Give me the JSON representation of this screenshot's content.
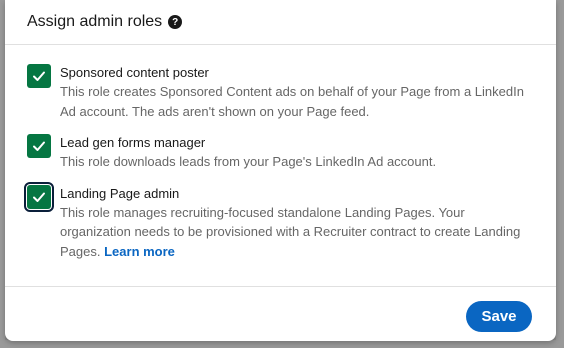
{
  "modal": {
    "title": "Assign admin roles",
    "help_icon": "question-circle-icon"
  },
  "roles": [
    {
      "title": "Sponsored content poster",
      "description": "This role creates Sponsored Content ads on behalf of your Page from a LinkedIn Ad account. The ads aren't shown on your Page feed.",
      "checked": true
    },
    {
      "title": "Lead gen forms manager",
      "description": "This role downloads leads from your Page's LinkedIn Ad account.",
      "checked": true
    },
    {
      "title": "Landing Page admin",
      "description": "This role manages recruiting-focused standalone Landing Pages. Your organization needs to be provisioned with a Recruiter contract to create Landing Pages.",
      "link_text": "Learn more",
      "checked": true
    }
  ],
  "footer": {
    "save_label": "Save"
  },
  "colors": {
    "checkbox": "#057642",
    "primary": "#0a66c2"
  }
}
